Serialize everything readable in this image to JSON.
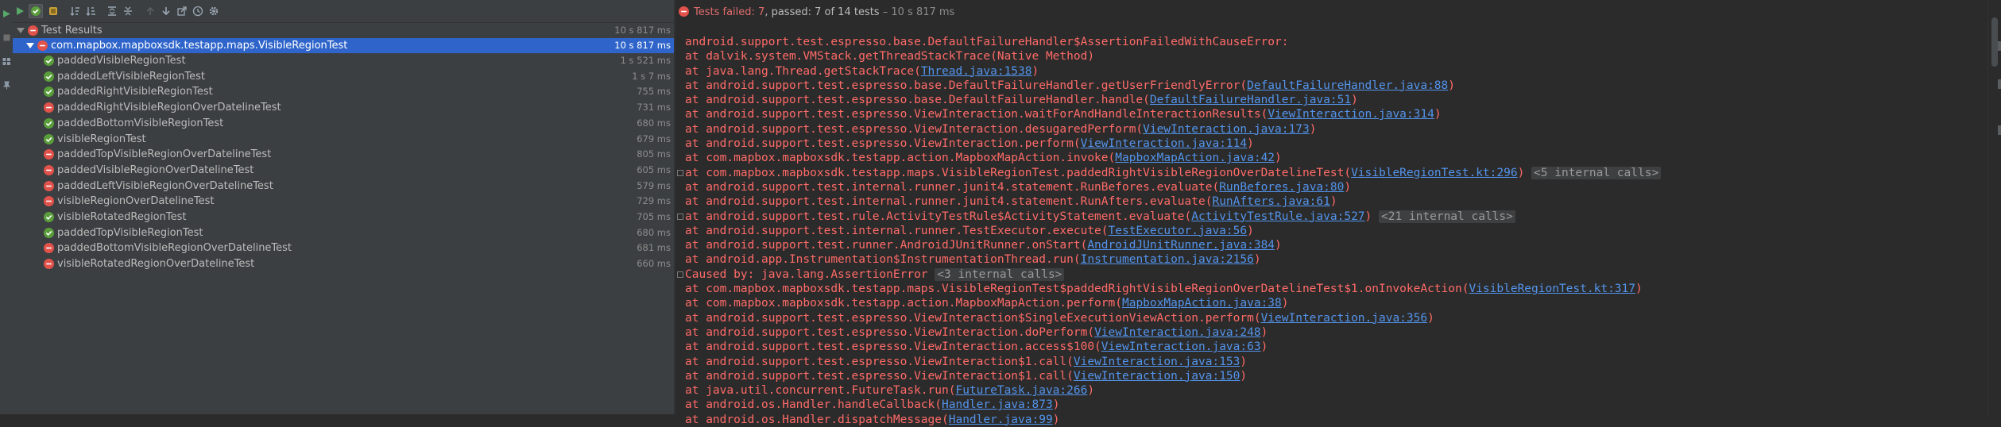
{
  "toolbar": {
    "icons": [
      "play-icon",
      "toggle-passed-icon",
      "toggle-ignored-icon",
      "sort-alpha-icon",
      "sort-duration-icon",
      "expand-all-icon",
      "collapse-all-icon",
      "previous-failed-icon",
      "next-failed-icon",
      "export-icon",
      "history-icon",
      "settings-icon"
    ]
  },
  "tree": {
    "root": {
      "label": "Test Results",
      "time": "10 s 817 ms",
      "status": "fail"
    },
    "suite": {
      "label": "com.mapbox.mapboxsdk.testapp.maps.VisibleRegionTest",
      "time": "10 s 817 ms",
      "status": "fail"
    },
    "tests": [
      {
        "label": "paddedVisibleRegionTest",
        "time": "1 s 521 ms",
        "status": "pass"
      },
      {
        "label": "paddedLeftVisibleRegionTest",
        "time": "1 s 7 ms",
        "status": "pass"
      },
      {
        "label": "paddedRightVisibleRegionTest",
        "time": "755 ms",
        "status": "pass"
      },
      {
        "label": "paddedRightVisibleRegionOverDatelineTest",
        "time": "731 ms",
        "status": "fail"
      },
      {
        "label": "paddedBottomVisibleRegionTest",
        "time": "680 ms",
        "status": "pass"
      },
      {
        "label": "visibleRegionTest",
        "time": "679 ms",
        "status": "pass"
      },
      {
        "label": "paddedTopVisibleRegionOverDatelineTest",
        "time": "805 ms",
        "status": "fail"
      },
      {
        "label": "paddedVisibleRegionOverDatelineTest",
        "time": "605 ms",
        "status": "fail"
      },
      {
        "label": "paddedLeftVisibleRegionOverDatelineTest",
        "time": "579 ms",
        "status": "fail"
      },
      {
        "label": "visibleRegionOverDatelineTest",
        "time": "729 ms",
        "status": "fail"
      },
      {
        "label": "visibleRotatedRegionTest",
        "time": "705 ms",
        "status": "pass"
      },
      {
        "label": "paddedTopVisibleRegionTest",
        "time": "680 ms",
        "status": "pass"
      },
      {
        "label": "paddedBottomVisibleRegionOverDatelineTest",
        "time": "681 ms",
        "status": "fail"
      },
      {
        "label": "visibleRotatedRegionOverDatelineTest",
        "time": "660 ms",
        "status": "fail"
      }
    ]
  },
  "status_bar": {
    "failed_label": "Tests failed: 7",
    "passed_label": ", passed: 7",
    "of_label": " of 14 tests",
    "duration_label": " – 10 s 817 ms"
  },
  "console": {
    "lines": [
      {
        "segments": [
          {
            "t": "android.support.test.espresso.base.DefaultFailureHandler$AssertionFailedWithCauseError:"
          }
        ]
      },
      {
        "segments": [
          {
            "t": "at dalvik.system.VMStack.getThreadStackTrace(Native Method)"
          }
        ]
      },
      {
        "segments": [
          {
            "t": "at java.lang.Thread.getStackTrace("
          },
          {
            "t": "Thread.java:1538",
            "link": true
          },
          {
            "t": ")"
          }
        ]
      },
      {
        "segments": [
          {
            "t": "at android.support.test.espresso.base.DefaultFailureHandler.getUserFriendlyError("
          },
          {
            "t": "DefaultFailureHandler.java:88",
            "link": true
          },
          {
            "t": ")"
          }
        ]
      },
      {
        "segments": [
          {
            "t": "at android.support.test.espresso.base.DefaultFailureHandler.handle("
          },
          {
            "t": "DefaultFailureHandler.java:51",
            "link": true
          },
          {
            "t": ")"
          }
        ]
      },
      {
        "segments": [
          {
            "t": "at android.support.test.espresso.ViewInteraction.waitForAndHandleInteractionResults("
          },
          {
            "t": "ViewInteraction.java:314",
            "link": true
          },
          {
            "t": ")"
          }
        ]
      },
      {
        "segments": [
          {
            "t": "at android.support.test.espresso.ViewInteraction.desugaredPerform("
          },
          {
            "t": "ViewInteraction.java:173",
            "link": true
          },
          {
            "t": ")"
          }
        ]
      },
      {
        "segments": [
          {
            "t": "at android.support.test.espresso.ViewInteraction.perform("
          },
          {
            "t": "ViewInteraction.java:114",
            "link": true
          },
          {
            "t": ")"
          }
        ]
      },
      {
        "segments": [
          {
            "t": "at com.mapbox.mapboxsdk.testapp.action.MapboxMapAction.invoke("
          },
          {
            "t": "MapboxMapAction.java:42",
            "link": true
          },
          {
            "t": ")"
          }
        ]
      },
      {
        "segments": [
          {
            "t": "at com.mapbox.mapboxsdk.testapp.maps.VisibleRegionTest.paddedRightVisibleRegionOverDatelineTest("
          },
          {
            "t": "VisibleRegionTest.kt:296",
            "link": true
          },
          {
            "t": ") "
          },
          {
            "t": "<5 internal calls>",
            "internal": true
          }
        ],
        "fold": true
      },
      {
        "segments": [
          {
            "t": "at android.support.test.internal.runner.junit4.statement.RunBefores.evaluate("
          },
          {
            "t": "RunBefores.java:80",
            "link": true
          },
          {
            "t": ")"
          }
        ]
      },
      {
        "segments": [
          {
            "t": "at android.support.test.internal.runner.junit4.statement.RunAfters.evaluate("
          },
          {
            "t": "RunAfters.java:61",
            "link": true
          },
          {
            "t": ")"
          }
        ]
      },
      {
        "segments": [
          {
            "t": "at android.support.test.rule.ActivityTestRule$ActivityStatement.evaluate("
          },
          {
            "t": "ActivityTestRule.java:527",
            "link": true
          },
          {
            "t": ") "
          },
          {
            "t": "<21 internal calls>",
            "internal": true
          }
        ],
        "fold": true
      },
      {
        "segments": [
          {
            "t": "at android.support.test.internal.runner.TestExecutor.execute("
          },
          {
            "t": "TestExecutor.java:56",
            "link": true
          },
          {
            "t": ")"
          }
        ]
      },
      {
        "segments": [
          {
            "t": "at android.support.test.runner.AndroidJUnitRunner.onStart("
          },
          {
            "t": "AndroidJUnitRunner.java:384",
            "link": true
          },
          {
            "t": ")"
          }
        ]
      },
      {
        "segments": [
          {
            "t": "at android.app.Instrumentation$InstrumentationThread.run("
          },
          {
            "t": "Instrumentation.java:2156",
            "link": true
          },
          {
            "t": ")"
          }
        ]
      },
      {
        "segments": [
          {
            "t": "Caused by: java.lang.AssertionError "
          },
          {
            "t": "<3 internal calls>",
            "internal": true
          }
        ],
        "fold": true
      },
      {
        "segments": [
          {
            "t": "at com.mapbox.mapboxsdk.testapp.maps.VisibleRegionTest$paddedRightVisibleRegionOverDatelineTest$1.onInvokeAction("
          },
          {
            "t": "VisibleRegionTest.kt:317",
            "link": true
          },
          {
            "t": ")"
          }
        ]
      },
      {
        "segments": [
          {
            "t": "at com.mapbox.mapboxsdk.testapp.action.MapboxMapAction.perform("
          },
          {
            "t": "MapboxMapAction.java:38",
            "link": true
          },
          {
            "t": ")"
          }
        ]
      },
      {
        "segments": [
          {
            "t": "at android.support.test.espresso.ViewInteraction$SingleExecutionViewAction.perform("
          },
          {
            "t": "ViewInteraction.java:356",
            "link": true
          },
          {
            "t": ")"
          }
        ]
      },
      {
        "segments": [
          {
            "t": "at android.support.test.espresso.ViewInteraction.doPerform("
          },
          {
            "t": "ViewInteraction.java:248",
            "link": true
          },
          {
            "t": ")"
          }
        ]
      },
      {
        "segments": [
          {
            "t": "at android.support.test.espresso.ViewInteraction.access$100("
          },
          {
            "t": "ViewInteraction.java:63",
            "link": true
          },
          {
            "t": ")"
          }
        ]
      },
      {
        "segments": [
          {
            "t": "at android.support.test.espresso.ViewInteraction$1.call("
          },
          {
            "t": "ViewInteraction.java:153",
            "link": true
          },
          {
            "t": ")"
          }
        ]
      },
      {
        "segments": [
          {
            "t": "at android.support.test.espresso.ViewInteraction$1.call("
          },
          {
            "t": "ViewInteraction.java:150",
            "link": true
          },
          {
            "t": ")"
          }
        ]
      },
      {
        "segments": [
          {
            "t": "at java.util.concurrent.FutureTask.run("
          },
          {
            "t": "FutureTask.java:266",
            "link": true
          },
          {
            "t": ")"
          }
        ]
      },
      {
        "segments": [
          {
            "t": "at android.os.Handler.handleCallback("
          },
          {
            "t": "Handler.java:873",
            "link": true
          },
          {
            "t": ")"
          }
        ]
      },
      {
        "segments": [
          {
            "t": "at android.os.Handler.dispatchMessage("
          },
          {
            "t": "Handler.java:99",
            "link": true
          },
          {
            "t": ")"
          }
        ]
      }
    ]
  },
  "colors": {
    "fail": "#e0524b",
    "pass": "#5a9e3c",
    "selection": "#2f65ca",
    "error_text": "#ff6b68",
    "link": "#5394ec"
  }
}
